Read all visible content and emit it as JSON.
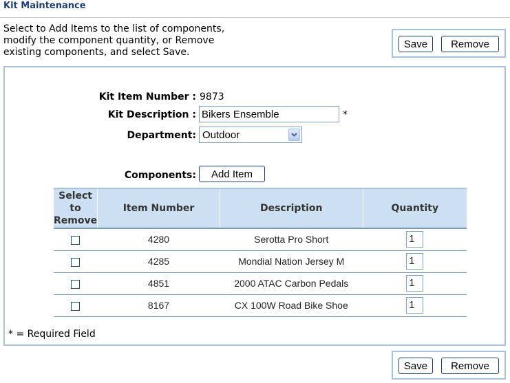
{
  "header": {
    "title": "Kit Maintenance"
  },
  "instructions": "Select to Add Items to the list of components, modify the component quantity, or Remove existing components, and select Save.",
  "actions": {
    "save_label": "Save",
    "remove_label": "Remove"
  },
  "form": {
    "kit_item_number_label": "Kit Item Number :",
    "kit_item_number_value": "9873",
    "kit_description_label": "Kit Description :",
    "kit_description_value": "Bikers Ensemble",
    "required_marker": "*",
    "department_label": "Department:",
    "department_value": "Outdoor",
    "components_label": "Components:",
    "add_item_label": "Add Item"
  },
  "components_table": {
    "headers": {
      "select": "Select to Remove",
      "item_number": "Item Number",
      "description": "Description",
      "quantity": "Quantity"
    },
    "rows": [
      {
        "item_number": "4280",
        "description": "Serotta Pro Short",
        "quantity": "1",
        "selected": false
      },
      {
        "item_number": "4285",
        "description": "Mondial Nation Jersey M",
        "quantity": "1",
        "selected": false
      },
      {
        "item_number": "4851",
        "description": "2000 ATAC Carbon Pedals",
        "quantity": "1",
        "selected": false
      },
      {
        "item_number": "8167",
        "description": "CX 100W Road Bike Shoe",
        "quantity": "1",
        "selected": false
      }
    ]
  },
  "required_note": "* = Required Field",
  "icons": {
    "dropdown": "chevron-down-icon"
  },
  "colors": {
    "title": "#1f3e74",
    "panel_border": "#a7c2dc",
    "table_header_bg": "#cddff2"
  }
}
